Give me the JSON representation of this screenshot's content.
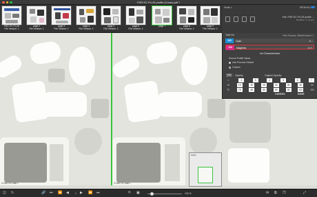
{
  "window": {
    "title": "PSR EC PLUS profile (Cross).pdf *",
    "lights": [
      "#ff5f57",
      "#febc2e",
      "#28c840"
    ]
  },
  "thumbnails": [
    {
      "label": "PSR EC PLUS",
      "version": "File Version: 1",
      "selected": false
    },
    {
      "label": "page 2",
      "version": "File Version: 1",
      "selected": false
    },
    {
      "label": "page 3",
      "version": "File Version: 1",
      "selected": false
    },
    {
      "label": "page 4",
      "version": "File Version: 1",
      "selected": false
    },
    {
      "label": "page 5",
      "version": "File Version: 1",
      "selected": false
    },
    {
      "label": "page 6",
      "version": "File Version: 1",
      "selected": false
    },
    {
      "label": "page 7",
      "version": "",
      "selected": true
    },
    {
      "label": "page 8",
      "version": "File Version: 1",
      "selected": false
    },
    {
      "label": "page 9",
      "version": "File Version: 1",
      "selected": false
    }
  ],
  "right_top": {
    "mode_label": "Studio ▾",
    "show_all": "SHOW ALL",
    "file_name": "File: PSR EC PLUS profile ...",
    "file_sub": "Modified • 1 version",
    "more": "…"
  },
  "ink_panel": {
    "total_ink": "Total Ink:",
    "preset": "Print Process: Offset/Gravure ⓘ",
    "inks": [
      {
        "pct": "100",
        "name": "Cyan",
        "icons": "⧉ ↓"
      },
      {
        "pct": "100",
        "name": "Magenta",
        "icons": "⧉ ✕"
      }
    ],
    "heading": "Ink Characteristics",
    "source_profile": "Source Profile Name",
    "opt_process": "Use Process Default",
    "opt_custom": "Custom",
    "opacity_btn": "100",
    "opacity_label": "Opacity",
    "original_opacity": "Original Opacity:",
    "row1": [
      "1",
      "2",
      "3",
      "4",
      "5",
      "6",
      "7"
    ],
    "row2_start": "10",
    "row2": [
      "15",
      "20",
      "25",
      "30",
      "35",
      "40"
    ],
    "row3_start": "70",
    "row3": [
      "75",
      "80",
      "85",
      "90",
      "95",
      "100"
    ],
    "row2_end": "50",
    "row3_end": "100",
    "cancel": "CANCEL",
    "save": "SAVE"
  },
  "panes": {
    "left_label": "COMET32 total 1",
    "right_label": "COMET32 total 1"
  },
  "minimap": {
    "label": "100%"
  },
  "bottom": {
    "zoom": "100 %",
    "page_input": "1"
  },
  "colors": {
    "selection_green": "#37c43b",
    "cyan": "#1e8fd8",
    "magenta": "#d92a84",
    "alert_red": "#e23b3b"
  }
}
